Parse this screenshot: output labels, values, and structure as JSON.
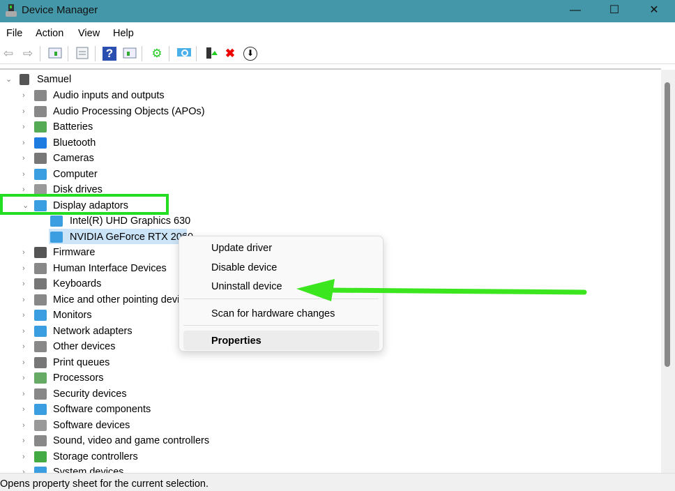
{
  "window": {
    "title": "Device Manager",
    "minimize": "—",
    "maximize": "☐",
    "close": "✕"
  },
  "menu": [
    "File",
    "Action",
    "View",
    "Help"
  ],
  "toolbar": [
    "back-icon",
    "forward-icon",
    "show-hide-console-tree-icon",
    "properties-icon",
    "help-icon",
    "show-action-pane-icon",
    "update-driver-icon",
    "scan-hardware-icon",
    "enable-device-icon",
    "uninstall-icon",
    "download-icon"
  ],
  "tree": {
    "root": "Samuel",
    "items": [
      {
        "label": "Audio inputs and outputs",
        "color": "#888"
      },
      {
        "label": "Audio Processing Objects (APOs)",
        "color": "#888"
      },
      {
        "label": "Batteries",
        "color": "#5a5"
      },
      {
        "label": "Bluetooth",
        "color": "#1e7be0"
      },
      {
        "label": "Cameras",
        "color": "#777"
      },
      {
        "label": "Computer",
        "color": "#3a9ee0"
      },
      {
        "label": "Disk drives",
        "color": "#999"
      },
      {
        "label": "Display adaptors",
        "color": "#3a9ee0",
        "expanded": true
      },
      {
        "label": "Intel(R) UHD Graphics 630",
        "color": "#3a9ee0",
        "child": true
      },
      {
        "label": "NVIDIA GeForce RTX 2060",
        "color": "#3a9ee0",
        "child": true
      },
      {
        "label": "Firmware",
        "color": "#555"
      },
      {
        "label": "Human Interface Devices",
        "color": "#888"
      },
      {
        "label": "Keyboards",
        "color": "#777"
      },
      {
        "label": "Mice and other pointing devices",
        "color": "#888"
      },
      {
        "label": "Monitors",
        "color": "#3a9ee0"
      },
      {
        "label": "Network adapters",
        "color": "#3a9ee0"
      },
      {
        "label": "Other devices",
        "color": "#888"
      },
      {
        "label": "Print queues",
        "color": "#777"
      },
      {
        "label": "Processors",
        "color": "#6a6"
      },
      {
        "label": "Security devices",
        "color": "#888"
      },
      {
        "label": "Software components",
        "color": "#3a9ee0"
      },
      {
        "label": "Software devices",
        "color": "#999"
      },
      {
        "label": "Sound, video and game controllers",
        "color": "#888"
      },
      {
        "label": "Storage controllers",
        "color": "#4a4"
      },
      {
        "label": "System devices",
        "color": "#3a9ee0"
      }
    ]
  },
  "context_menu": {
    "items": [
      "Update driver",
      "Disable device",
      "Uninstall device",
      "Scan for hardware changes",
      "Properties"
    ]
  },
  "status": "Opens property sheet for the current selection.",
  "colors": {
    "highlight": "#22dd22",
    "titlebar": "#4497a8"
  }
}
